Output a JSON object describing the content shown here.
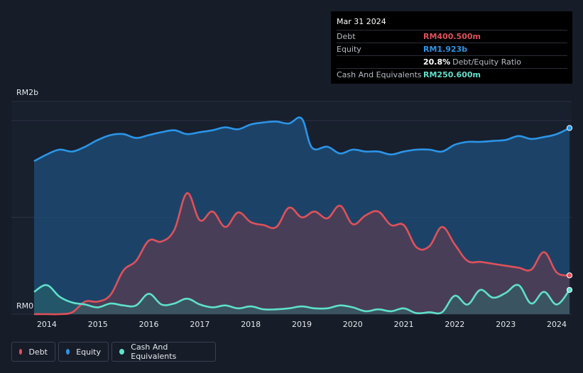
{
  "tooltip": {
    "date": "Mar 31 2024",
    "rows": [
      {
        "label": "Debt",
        "value": "RM400.500m",
        "color": "#e0515a"
      },
      {
        "label": "Equity",
        "value": "RM1.923b",
        "color": "#2b95e8"
      },
      {
        "label": "",
        "value": "20.8%",
        "suffix": "Debt/Equity Ratio",
        "color": "#ffffff"
      },
      {
        "label": "Cash And Equivalents",
        "value": "RM250.600m",
        "color": "#5fe0cb"
      }
    ]
  },
  "legend": [
    {
      "label": "Debt",
      "color": "#e0515a"
    },
    {
      "label": "Equity",
      "color": "#2b95e8"
    },
    {
      "label": "Cash And Equivalents",
      "color": "#5fe0cb"
    }
  ],
  "chart_data": {
    "type": "area",
    "ylim": [
      0,
      2
    ],
    "yunit": "RM billions",
    "ytick_labels": [
      {
        "value": 2,
        "label": "RM2b"
      },
      {
        "value": 0,
        "label": "RM0"
      }
    ],
    "xlim": [
      2013.75,
      2024.25
    ],
    "xticks": [
      2014,
      2015,
      2016,
      2017,
      2018,
      2019,
      2020,
      2021,
      2022,
      2023,
      2024
    ],
    "xtick_labels": [
      "2014",
      "2015",
      "2016",
      "2017",
      "2018",
      "2019",
      "2020",
      "2021",
      "2022",
      "2023",
      "2024"
    ],
    "series": [
      {
        "name": "Equity",
        "color": "#2b95e8",
        "points": [
          [
            2013.75,
            1.58
          ],
          [
            2014.0,
            1.65
          ],
          [
            2014.25,
            1.7
          ],
          [
            2014.5,
            1.68
          ],
          [
            2014.75,
            1.73
          ],
          [
            2015.0,
            1.8
          ],
          [
            2015.25,
            1.85
          ],
          [
            2015.5,
            1.86
          ],
          [
            2015.75,
            1.82
          ],
          [
            2016.0,
            1.85
          ],
          [
            2016.25,
            1.88
          ],
          [
            2016.5,
            1.9
          ],
          [
            2016.75,
            1.86
          ],
          [
            2017.0,
            1.88
          ],
          [
            2017.25,
            1.9
          ],
          [
            2017.5,
            1.93
          ],
          [
            2017.75,
            1.91
          ],
          [
            2018.0,
            1.96
          ],
          [
            2018.25,
            1.98
          ],
          [
            2018.5,
            1.99
          ],
          [
            2018.75,
            1.97
          ],
          [
            2019.0,
            2.02
          ],
          [
            2019.2,
            1.72
          ],
          [
            2019.5,
            1.73
          ],
          [
            2019.75,
            1.66
          ],
          [
            2020.0,
            1.7
          ],
          [
            2020.25,
            1.68
          ],
          [
            2020.5,
            1.68
          ],
          [
            2020.75,
            1.65
          ],
          [
            2021.0,
            1.68
          ],
          [
            2021.25,
            1.7
          ],
          [
            2021.5,
            1.7
          ],
          [
            2021.75,
            1.68
          ],
          [
            2022.0,
            1.75
          ],
          [
            2022.25,
            1.78
          ],
          [
            2022.5,
            1.78
          ],
          [
            2022.75,
            1.79
          ],
          [
            2023.0,
            1.8
          ],
          [
            2023.25,
            1.84
          ],
          [
            2023.5,
            1.81
          ],
          [
            2023.75,
            1.83
          ],
          [
            2024.0,
            1.86
          ],
          [
            2024.25,
            1.923
          ]
        ]
      },
      {
        "name": "Debt",
        "color": "#e0515a",
        "points": [
          [
            2013.75,
            0.0
          ],
          [
            2014.0,
            0.0
          ],
          [
            2014.25,
            0.0
          ],
          [
            2014.5,
            0.02
          ],
          [
            2014.75,
            0.13
          ],
          [
            2015.0,
            0.13
          ],
          [
            2015.25,
            0.2
          ],
          [
            2015.5,
            0.45
          ],
          [
            2015.75,
            0.55
          ],
          [
            2016.0,
            0.76
          ],
          [
            2016.25,
            0.75
          ],
          [
            2016.5,
            0.87
          ],
          [
            2016.75,
            1.25
          ],
          [
            2017.0,
            0.97
          ],
          [
            2017.25,
            1.06
          ],
          [
            2017.5,
            0.9
          ],
          [
            2017.75,
            1.05
          ],
          [
            2018.0,
            0.95
          ],
          [
            2018.25,
            0.92
          ],
          [
            2018.5,
            0.9
          ],
          [
            2018.75,
            1.1
          ],
          [
            2019.0,
            1.0
          ],
          [
            2019.25,
            1.06
          ],
          [
            2019.5,
            0.99
          ],
          [
            2019.75,
            1.12
          ],
          [
            2020.0,
            0.93
          ],
          [
            2020.25,
            1.02
          ],
          [
            2020.5,
            1.06
          ],
          [
            2020.75,
            0.92
          ],
          [
            2021.0,
            0.92
          ],
          [
            2021.25,
            0.69
          ],
          [
            2021.5,
            0.7
          ],
          [
            2021.75,
            0.9
          ],
          [
            2022.0,
            0.72
          ],
          [
            2022.25,
            0.55
          ],
          [
            2022.5,
            0.54
          ],
          [
            2022.75,
            0.52
          ],
          [
            2023.0,
            0.5
          ],
          [
            2023.25,
            0.48
          ],
          [
            2023.5,
            0.46
          ],
          [
            2023.75,
            0.64
          ],
          [
            2024.0,
            0.43
          ],
          [
            2024.25,
            0.4005
          ]
        ]
      },
      {
        "name": "Cash And Equivalents",
        "color": "#5fe0cb",
        "points": [
          [
            2013.75,
            0.23
          ],
          [
            2014.0,
            0.3
          ],
          [
            2014.25,
            0.18
          ],
          [
            2014.5,
            0.12
          ],
          [
            2014.75,
            0.1
          ],
          [
            2015.0,
            0.07
          ],
          [
            2015.25,
            0.11
          ],
          [
            2015.5,
            0.09
          ],
          [
            2015.75,
            0.09
          ],
          [
            2016.0,
            0.21
          ],
          [
            2016.25,
            0.1
          ],
          [
            2016.5,
            0.11
          ],
          [
            2016.75,
            0.16
          ],
          [
            2017.0,
            0.1
          ],
          [
            2017.25,
            0.07
          ],
          [
            2017.5,
            0.09
          ],
          [
            2017.75,
            0.06
          ],
          [
            2018.0,
            0.08
          ],
          [
            2018.25,
            0.05
          ],
          [
            2018.5,
            0.05
          ],
          [
            2018.75,
            0.06
          ],
          [
            2019.0,
            0.08
          ],
          [
            2019.25,
            0.06
          ],
          [
            2019.5,
            0.06
          ],
          [
            2019.75,
            0.09
          ],
          [
            2020.0,
            0.07
          ],
          [
            2020.25,
            0.03
          ],
          [
            2020.5,
            0.05
          ],
          [
            2020.75,
            0.03
          ],
          [
            2021.0,
            0.06
          ],
          [
            2021.25,
            0.01
          ],
          [
            2021.5,
            0.02
          ],
          [
            2021.75,
            0.02
          ],
          [
            2022.0,
            0.19
          ],
          [
            2022.25,
            0.1
          ],
          [
            2022.5,
            0.25
          ],
          [
            2022.75,
            0.17
          ],
          [
            2023.0,
            0.22
          ],
          [
            2023.25,
            0.3
          ],
          [
            2023.5,
            0.11
          ],
          [
            2023.75,
            0.23
          ],
          [
            2024.0,
            0.1
          ],
          [
            2024.25,
            0.2506
          ]
        ]
      }
    ]
  }
}
